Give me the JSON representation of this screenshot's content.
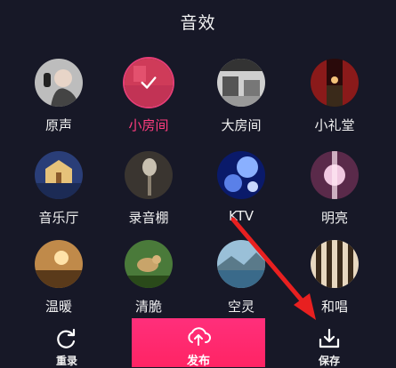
{
  "title": "音效",
  "effects": [
    {
      "label": "原声",
      "selected": false
    },
    {
      "label": "小房间",
      "selected": true
    },
    {
      "label": "大房间",
      "selected": false
    },
    {
      "label": "小礼堂",
      "selected": false
    },
    {
      "label": "音乐厅",
      "selected": false
    },
    {
      "label": "录音棚",
      "selected": false
    },
    {
      "label": "KTV",
      "selected": false
    },
    {
      "label": "明亮",
      "selected": false
    },
    {
      "label": "温暖",
      "selected": false
    },
    {
      "label": "清脆",
      "selected": false
    },
    {
      "label": "空灵",
      "selected": false
    },
    {
      "label": "和唱",
      "selected": false
    }
  ],
  "toolbar": {
    "reset_label": "重录",
    "publish_label": "发布",
    "save_label": "保存"
  },
  "colors": {
    "background": "#171827",
    "accent": "#ff2f7b",
    "annotation_arrow": "#e82020"
  }
}
